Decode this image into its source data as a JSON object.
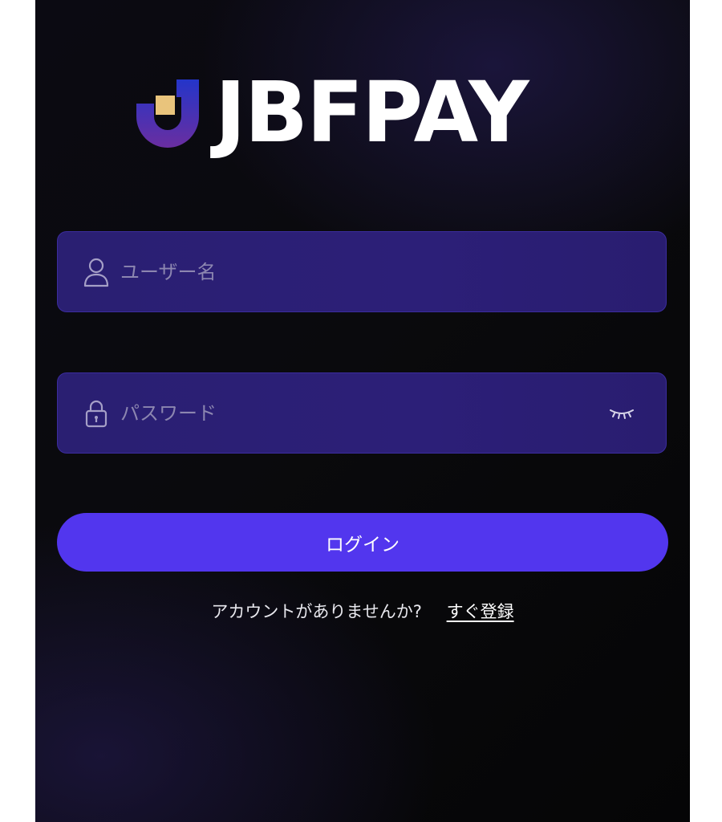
{
  "brand": {
    "name": "JBFPAY",
    "mark_icon": "jbfpay-logo-icon",
    "colors": {
      "mark_blue": "#2435c9",
      "mark_purple": "#6a2ea0",
      "mark_gold": "#e9c47c"
    }
  },
  "form": {
    "username": {
      "icon": "user-icon",
      "placeholder": "ユーザー名",
      "value": ""
    },
    "password": {
      "icon": "lock-icon",
      "placeholder": "パスワード",
      "value": "",
      "toggle_icon": "eye-closed-icon"
    },
    "login_label": "ログイン"
  },
  "register": {
    "question": "アカウントがありませんか?",
    "link_label": "すぐ登録"
  },
  "colors": {
    "accent": "#5236ee",
    "field_bg": "#2a1f72",
    "background": "#0a0a0d"
  }
}
